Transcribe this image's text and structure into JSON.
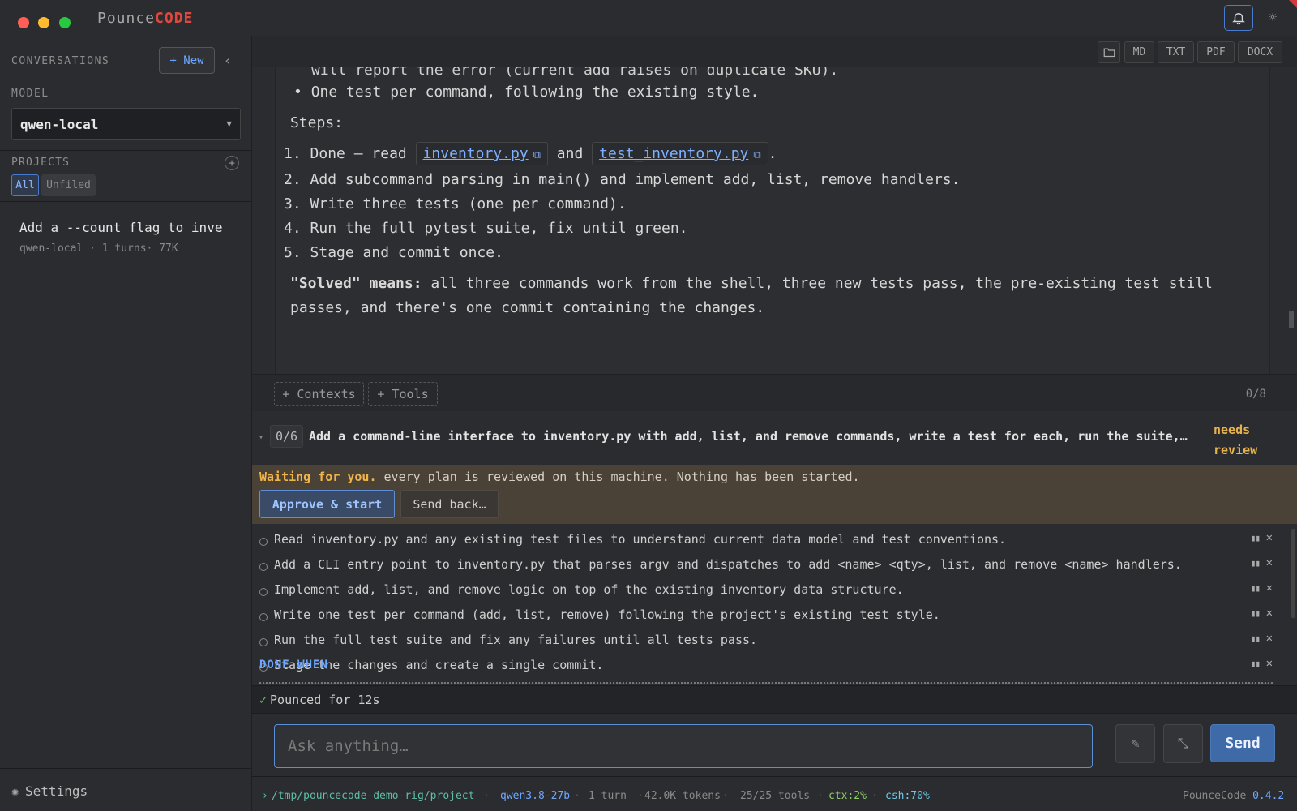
{
  "app": {
    "brand_part1": "Pounce",
    "brand_part2": "CODE"
  },
  "sidebar": {
    "conversations_label": "CONVERSATIONS",
    "new_button": "+ New",
    "collapse_icon": "chevron-left",
    "model_label": "MODEL",
    "model_value": "qwen-local",
    "projects_label": "PROJECTS",
    "filters": [
      "All",
      "Unfiled"
    ],
    "active_filter": "All",
    "conversations": [
      {
        "title": "Add a --count flag to inve",
        "meta": "qwen-local · 1 turns· 77K"
      }
    ],
    "settings_label": "Settings"
  },
  "toolbar": {
    "export_buttons": [
      "MD",
      "TXT",
      "PDF",
      "DOCX"
    ]
  },
  "content": {
    "line_cut": "will report the error (current add raises on duplicate SKU).",
    "bullet": "One test per command, following the existing style.",
    "steps_label": "Steps:",
    "step1_num": "1.",
    "step1_pre": "Done — read",
    "step1_link1": "inventory.py",
    "step1_mid": "and",
    "step1_link2": "test_inventory.py",
    "step1_post": ".",
    "steps": [
      {
        "num": "2.",
        "text": "Add subcommand parsing in main() and implement add, list, remove handlers."
      },
      {
        "num": "3.",
        "text": "Write three tests (one per command)."
      },
      {
        "num": "4.",
        "text": "Run the full pytest suite, fix until green."
      },
      {
        "num": "5.",
        "text": "Stage and commit once."
      }
    ],
    "solved_bold": "\"Solved\" means:",
    "solved_rest1": "all three commands work from the shell, three new tests pass, the pre-existing test still",
    "solved_rest2": "passes, and there's one commit containing the changes."
  },
  "context_row": {
    "contexts_button": "+ Contexts",
    "tools_button": "+ Tools",
    "count": "0/8"
  },
  "plan": {
    "progress": "0/6",
    "title": "Add a command-line interface to inventory.py with add, list, and remove commands, write a test for each, run the suite, and commit.",
    "status_line1": "needs",
    "status_line2": "review",
    "waiting_bold": "Waiting for you.",
    "waiting_rest": " every plan is reviewed on this machine. Nothing has been started.",
    "approve_button": "Approve & start",
    "send_back_button": "Send back…",
    "steps": [
      "Read inventory.py and any existing test files to understand current data model and test conventions.",
      "Add a CLI entry point to inventory.py that parses argv and dispatches to add <name> <qty>, list, and remove <name> handlers.",
      "Implement add, list, and remove logic on top of the existing inventory data structure.",
      "Write one test per command (add, list, remove) following the project's existing test style.",
      "Run the full test suite and fix any failures until all tests pass.",
      "Stage the changes and create a single commit."
    ],
    "done_when_label": "DONE WHEN"
  },
  "pounced": {
    "text": "Pounced for 12s"
  },
  "composer": {
    "placeholder": "Ask anything…",
    "send_button": "Send"
  },
  "status_bar": {
    "path": "/tmp/pouncecode-demo-rig/project",
    "model": "qwen3.8-27b",
    "turns": "1 turn",
    "tokens": "42.0K tokens",
    "tools": "25/25 tools",
    "ctx": "ctx:2%",
    "csh": "csh:70%",
    "app_name": "PounceCode",
    "version": "0.4.2"
  },
  "colors": {
    "accent_blue": "#6ea6ff",
    "brand_red": "#e0473f",
    "warning_amber": "#e6b24c",
    "success_green": "#5fbf6a"
  }
}
